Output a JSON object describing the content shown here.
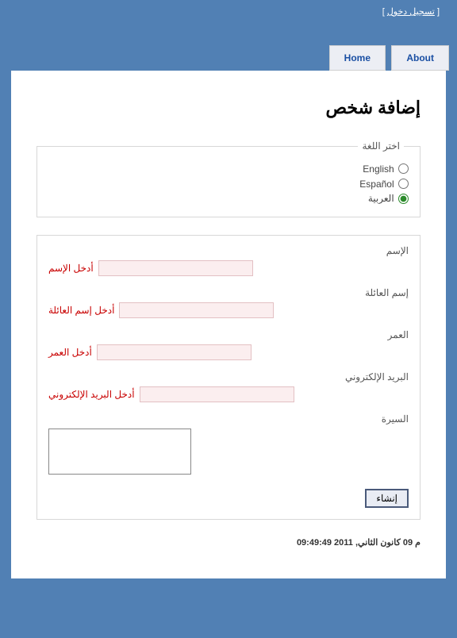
{
  "login": {
    "open": "[",
    "link": "تسجيل دخول",
    "close": "]"
  },
  "nav": {
    "home": "Home",
    "about": "About"
  },
  "page": {
    "title": "إضافة شخص"
  },
  "langBox": {
    "legend": "اختر اللغة",
    "options": {
      "en": "English",
      "es": "Español",
      "ar": "العربية"
    },
    "selected": "ar"
  },
  "form": {
    "name": {
      "label": "الإسم",
      "value": "",
      "error": "أدخل الإسم"
    },
    "family": {
      "label": "إسم العائلة",
      "value": "",
      "error": "أدخل إسم العائلة"
    },
    "age": {
      "label": "العمر",
      "value": "",
      "error": "أدخل العمر"
    },
    "email": {
      "label": "البريد الإلكتروني",
      "value": "",
      "error": "أدخل البريد الإلكتروني"
    },
    "bio": {
      "label": "السيرة",
      "value": ""
    },
    "submit": "إنشاء"
  },
  "timestamp": "م 09 كانون الثاني, 2011 09:49:49"
}
